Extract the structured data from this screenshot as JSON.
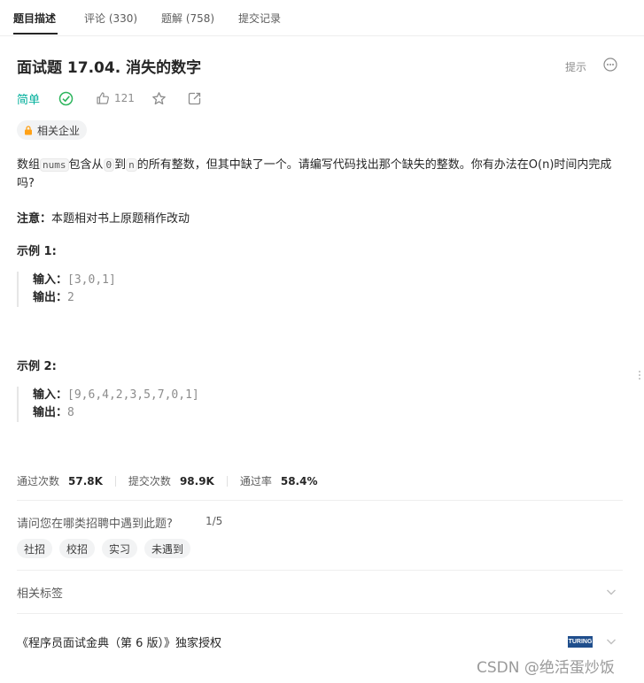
{
  "tabs": [
    {
      "label": "题目描述",
      "active": true
    },
    {
      "label": "评论 (330)",
      "active": false
    },
    {
      "label": "题解 (758)",
      "active": false
    },
    {
      "label": "提交记录",
      "active": false
    }
  ],
  "problem": {
    "title": "面试题 17.04. 消失的数字",
    "difficulty": "简单",
    "likes": "121",
    "hint_label": "提示",
    "company_tag": "相关企业"
  },
  "description": {
    "seg1": "数组",
    "code1": "nums",
    "seg2": "包含从",
    "code2": "0",
    "seg3": "到",
    "code3": "n",
    "seg4": "的所有整数，但其中缺了一个。请编写代码找出那个缺失的整数。你有办法在O(n)时间内完成吗?"
  },
  "note": {
    "label": "注意：",
    "text": "本题相对书上原题稍作改动"
  },
  "examples": [
    {
      "title": "示例 1:",
      "input_label": "输入：",
      "input": "[3,0,1]",
      "output_label": "输出：",
      "output": "2"
    },
    {
      "title": "示例 2:",
      "input_label": "输入：",
      "input": "[9,6,4,2,3,5,7,0,1]",
      "output_label": "输出：",
      "output": "8"
    }
  ],
  "stats": [
    {
      "label": "通过次数",
      "value": "57.8K"
    },
    {
      "label": "提交次数",
      "value": "98.9K"
    },
    {
      "label": "通过率",
      "value": "58.4%"
    }
  ],
  "survey": {
    "question": "请问您在哪类招聘中遇到此题?",
    "page": "1/5",
    "options": [
      "社招",
      "校招",
      "实习",
      "未遇到"
    ]
  },
  "related_tags_label": "相关标签",
  "book_label": "《程序员面试金典（第 6 版）》独家授权",
  "publisher_logo_text": "TURING",
  "watermark": "CSDN @绝活蛋炒饭",
  "colors": {
    "easy": "#00af9b",
    "accent_lock": "#ffa116",
    "text": "#262626",
    "muted": "#8c8c8c"
  }
}
